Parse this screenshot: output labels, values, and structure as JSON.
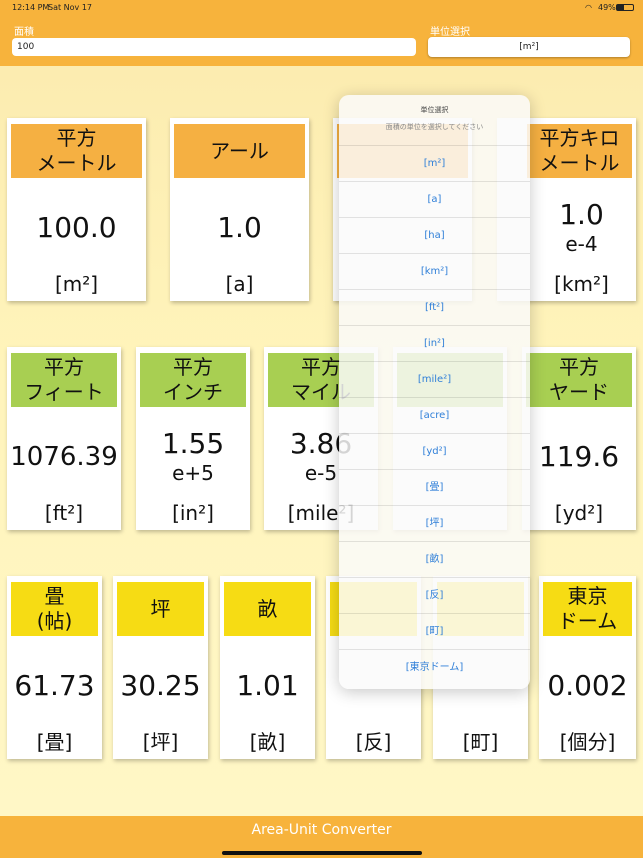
{
  "status": {
    "time": "12:14 PM",
    "date": "Sat Nov 17",
    "battery": "49%"
  },
  "header": {
    "area_label": "面積",
    "area_value": "100",
    "unit_label": "単位選択",
    "unit_value": "[m²]"
  },
  "cards": {
    "sqm": {
      "title": "平方\nメートル",
      "value": "100.0",
      "exp": "",
      "unit": "[m²]"
    },
    "are": {
      "title": "アール",
      "value": "1.0",
      "exp": "",
      "unit": "[a]"
    },
    "sqkm": {
      "title": "平方キロ\nメートル",
      "value": "1.0",
      "exp": "e-4",
      "unit": "[km²]"
    },
    "sqft": {
      "title": "平方\nフィート",
      "value": "1076.39",
      "exp": "",
      "unit": "[ft²]"
    },
    "sqin": {
      "title": "平方\nインチ",
      "value": "1.55",
      "exp": "e+5",
      "unit": "[in²]"
    },
    "sqmi": {
      "title": "平方\nマイル",
      "value": "3.86",
      "exp": "e-5",
      "unit": "[mile²]"
    },
    "sqyd": {
      "title": "平方\nヤード",
      "value": "119.6",
      "exp": "",
      "unit": "[yd²]"
    },
    "jo": {
      "title": "畳\n(帖)",
      "value": "61.73",
      "exp": "",
      "unit": "[畳]"
    },
    "tsubo": {
      "title": "坪",
      "value": "30.25",
      "exp": "",
      "unit": "[坪]"
    },
    "se": {
      "title": "畝",
      "value": "1.01",
      "exp": "",
      "unit": "[畝]"
    },
    "tan": {
      "title": "",
      "value": "",
      "exp": "",
      "unit": "[反]"
    },
    "cho": {
      "title": "",
      "value": "",
      "exp": "",
      "unit": "[町]"
    },
    "dome": {
      "title": "東京\nドーム",
      "value": "0.002",
      "exp": "",
      "unit": "[個分]"
    }
  },
  "popover": {
    "title": "単位選択",
    "message": "面積の単位を選択してください",
    "options": [
      "[m²]",
      "[a]",
      "[ha]",
      "[km²]",
      "[ft²]",
      "[in²]",
      "[mile²]",
      "[acre]",
      "[yd²]",
      "[畳]",
      "[坪]",
      "[畝]",
      "[反]",
      "[町]",
      "[東京ドーム]"
    ]
  },
  "footer": {
    "title": "Area-Unit Converter"
  },
  "colors": {
    "bar": "#f7b33c",
    "orange": "#f5b042",
    "green": "#a8cf52",
    "yellow": "#f6dc14",
    "link": "#2f7fd8"
  }
}
